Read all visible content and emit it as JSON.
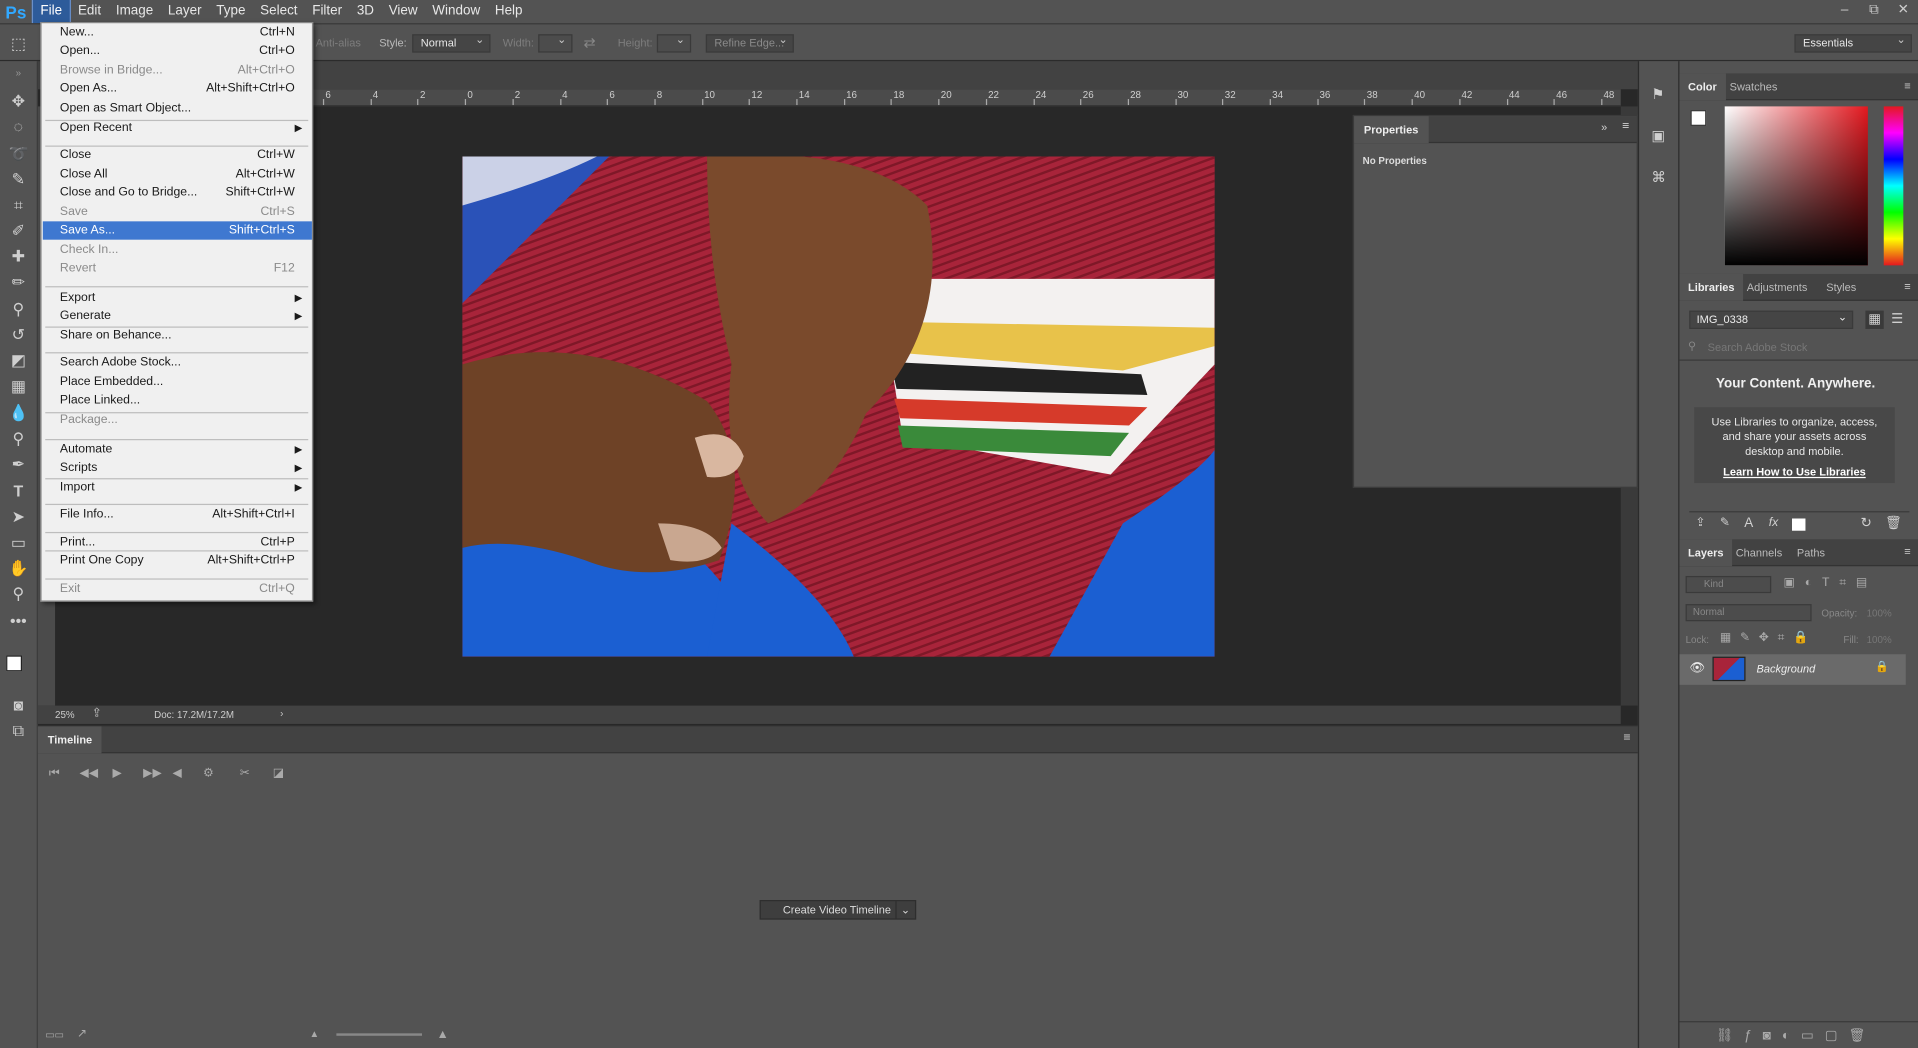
{
  "app": {
    "logo": "Ps"
  },
  "menubar": {
    "items": [
      "File",
      "Edit",
      "Image",
      "Layer",
      "Type",
      "Select",
      "Filter",
      "3D",
      "View",
      "Window",
      "Help"
    ]
  },
  "window_controls": [
    "‒",
    "⧉",
    "✕"
  ],
  "options": {
    "anti_alias": "Anti-alias",
    "style_label": "Style:",
    "style_value": "Normal",
    "width_label": "Width:",
    "height_label": "Height:",
    "refine": "Refine Edge...",
    "workspace": "Essentials"
  },
  "ruler": {
    "ticks": [
      "6",
      "4",
      "2",
      "0",
      "2",
      "4",
      "6",
      "8",
      "10",
      "12",
      "14",
      "16",
      "18",
      "20",
      "22",
      "24",
      "26",
      "28",
      "30",
      "32",
      "34",
      "36",
      "38",
      "40",
      "42",
      "44",
      "46",
      "48"
    ]
  },
  "status": {
    "zoom": "25%",
    "doc": "Doc: 17.2M/17.2M"
  },
  "properties": {
    "tab": "Properties",
    "text": "No Properties"
  },
  "timeline": {
    "tab": "Timeline",
    "button": "Create Video Timeline"
  },
  "color_panel": {
    "tabs": [
      "Color",
      "Swatches"
    ]
  },
  "libraries_panel": {
    "tabs": [
      "Libraries",
      "Adjustments",
      "Styles"
    ],
    "library": "IMG_0338",
    "search_placeholder": "Search Adobe Stock",
    "heading": "Your Content. Anywhere.",
    "body": "Use Libraries to organize, access, and share your assets across desktop and mobile.",
    "link": "Learn How to Use Libraries"
  },
  "layers_panel": {
    "tabs": [
      "Layers",
      "Channels",
      "Paths"
    ],
    "kind": "Kind",
    "blend": "Normal",
    "opacity_label": "Opacity:",
    "opacity_value": "100%",
    "lock_label": "Lock:",
    "fill_label": "Fill:",
    "fill_value": "100%",
    "layer_name": "Background"
  },
  "file_menu": [
    {
      "label": "New...",
      "shortcut": "Ctrl+N"
    },
    {
      "label": "Open...",
      "shortcut": "Ctrl+O"
    },
    {
      "label": "Browse in Bridge...",
      "shortcut": "Alt+Ctrl+O",
      "disabled": true
    },
    {
      "label": "Open As...",
      "shortcut": "Alt+Shift+Ctrl+O"
    },
    {
      "label": "Open as Smart Object...",
      "shortcut": ""
    },
    {
      "label": "Open Recent",
      "shortcut": "",
      "submenu": true
    },
    {
      "label": "Close",
      "shortcut": "Ctrl+W"
    },
    {
      "label": "Close All",
      "shortcut": "Alt+Ctrl+W"
    },
    {
      "label": "Close and Go to Bridge...",
      "shortcut": "Shift+Ctrl+W"
    },
    {
      "label": "Save",
      "shortcut": "Ctrl+S",
      "disabled": true
    },
    {
      "label": "Save As...",
      "shortcut": "Shift+Ctrl+S",
      "highlighted": true
    },
    {
      "label": "Check In...",
      "shortcut": "",
      "disabled": true
    },
    {
      "label": "Revert",
      "shortcut": "F12",
      "disabled": true
    },
    {
      "label": "Export",
      "shortcut": "",
      "submenu": true
    },
    {
      "label": "Generate",
      "shortcut": "",
      "submenu": true
    },
    {
      "label": "Share on Behance...",
      "shortcut": ""
    },
    {
      "label": "Search Adobe Stock...",
      "shortcut": ""
    },
    {
      "label": "Place Embedded...",
      "shortcut": ""
    },
    {
      "label": "Place Linked...",
      "shortcut": ""
    },
    {
      "label": "Package...",
      "shortcut": "",
      "disabled": true
    },
    {
      "label": "Automate",
      "shortcut": "",
      "submenu": true
    },
    {
      "label": "Scripts",
      "shortcut": "",
      "submenu": true
    },
    {
      "label": "Import",
      "shortcut": "",
      "submenu": true
    },
    {
      "label": "File Info...",
      "shortcut": "Alt+Shift+Ctrl+I"
    },
    {
      "label": "Print...",
      "shortcut": "Ctrl+P"
    },
    {
      "label": "Print One Copy",
      "shortcut": "Alt+Shift+Ctrl+P"
    },
    {
      "label": "Exit",
      "shortcut": "Ctrl+Q",
      "disabled": true
    }
  ],
  "colors": {
    "highlight": "#3f78d0",
    "ps_blue": "#31a8ff",
    "panel": "#535353"
  }
}
